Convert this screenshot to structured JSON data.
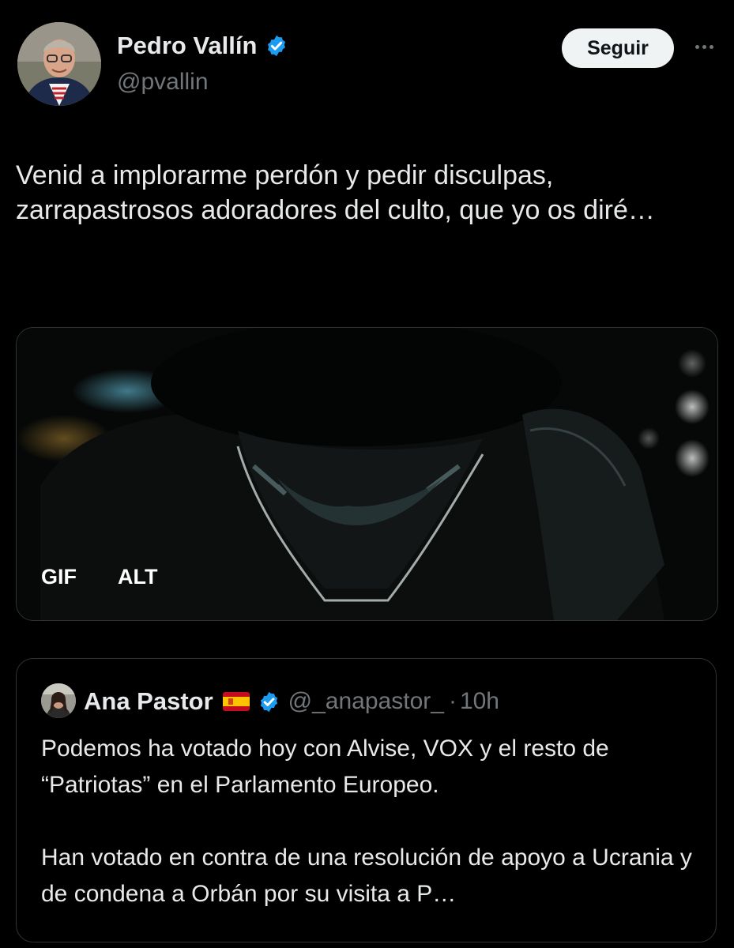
{
  "author": {
    "name": "Pedro Vallín",
    "handle": "@pvallin",
    "verified_icon": "verified-badge-icon",
    "avatar_icon": "profile-photo"
  },
  "actions": {
    "follow_label": "Seguir",
    "more_icon": "more-horizontal-icon"
  },
  "tweet": {
    "text": "Venid a implorarme perdón y pedir disculpas, zarrapastrosos adoradores del culto, que yo os diré…"
  },
  "media": {
    "type_badge": "GIF",
    "alt_badge": "ALT"
  },
  "quoted": {
    "name": "Ana Pastor",
    "flag_icon": "spain-flag-icon",
    "handle": "@_anapastor_",
    "separator": "·",
    "time": "10h",
    "paragraphs": [
      "Podemos ha votado hoy con Alvise, VOX y el resto de “Patriotas” en el Parlamento  Europeo.",
      "Han votado en contra de una resolución de apoyo a Ucrania y de condena a Orbán por su visita a P…"
    ]
  },
  "colors": {
    "background": "#000000",
    "text": "#e7e9ea",
    "secondary": "#71767b",
    "verified": "#1d9bf0",
    "border": "#2f3336"
  }
}
